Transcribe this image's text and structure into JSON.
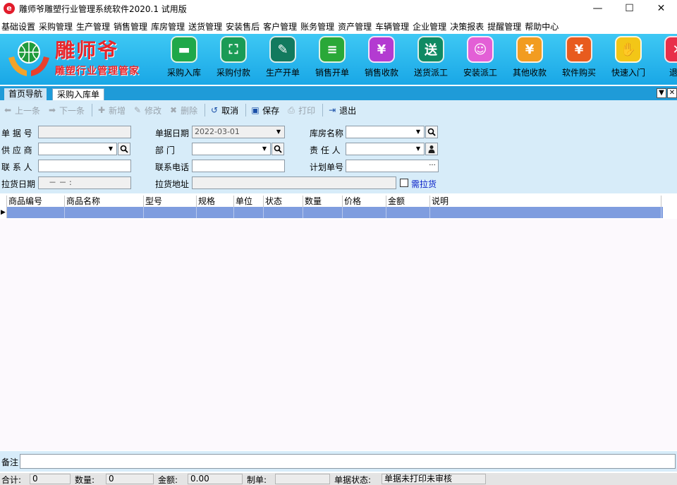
{
  "window": {
    "title": "雕师爷雕塑行业管理系统软件2020.1 试用版",
    "logo_glyph": "e",
    "minimize": "—",
    "maximize": "☐",
    "close": "✕"
  },
  "menu": [
    "基础设置",
    "采购管理",
    "生产管理",
    "销售管理",
    "库房管理",
    "送货管理",
    "安装售后",
    "客户管理",
    "账务管理",
    "资产管理",
    "车辆管理",
    "企业管理",
    "决策报表",
    "提醒管理",
    "帮助中心"
  ],
  "brand": {
    "name": "雕师爷",
    "subtitle": "雕塑行业管理管家"
  },
  "toolbar": [
    {
      "label": "采购入库",
      "icon": "folder-icon",
      "color": "#1fa84a",
      "glyph": "▬"
    },
    {
      "label": "采购付款",
      "icon": "scan-icon",
      "color": "#1a9b55",
      "glyph": "⛶"
    },
    {
      "label": "生产开单",
      "icon": "document-icon",
      "color": "#127a5e",
      "glyph": "✎"
    },
    {
      "label": "销售开单",
      "icon": "cart-doc-icon",
      "color": "#2aa838",
      "glyph": "≡"
    },
    {
      "label": "销售收款",
      "icon": "receipt-icon",
      "color": "#b33bd1",
      "glyph": "¥"
    },
    {
      "label": "送货派工",
      "icon": "truck-icon",
      "color": "#0f8a63",
      "glyph": "送"
    },
    {
      "label": "安装派工",
      "icon": "users-icon",
      "color": "#e35fd6",
      "glyph": "☺"
    },
    {
      "label": "其他收款",
      "icon": "money-bag-icon",
      "color": "#f29c20",
      "glyph": "¥"
    },
    {
      "label": "软件购买",
      "icon": "purchase-icon",
      "color": "#e85b1e",
      "glyph": "¥"
    },
    {
      "label": "快速入门",
      "icon": "hand-icon",
      "color": "#f3c617",
      "glyph": "✋"
    },
    {
      "label": "退出",
      "icon": "exit-icon",
      "color": "#e8304a",
      "glyph": "✕"
    }
  ],
  "tabs": {
    "home": "首页导航",
    "current": "采购入库单",
    "dropdown": "▼",
    "close": "✕"
  },
  "actions": [
    {
      "label": "上一条",
      "enabled": false,
      "icon": "prev-icon",
      "glyph": "⬅"
    },
    {
      "label": "下一条",
      "enabled": false,
      "icon": "next-icon",
      "glyph": "➡"
    },
    {
      "label": "新增",
      "enabled": false,
      "icon": "add-icon",
      "glyph": "✚"
    },
    {
      "label": "修改",
      "enabled": false,
      "icon": "edit-icon",
      "glyph": "✎"
    },
    {
      "label": "删除",
      "enabled": false,
      "icon": "delete-icon",
      "glyph": "✖"
    },
    {
      "label": "取消",
      "enabled": true,
      "icon": "cancel-icon",
      "glyph": "↺"
    },
    {
      "label": "保存",
      "enabled": true,
      "icon": "save-icon",
      "glyph": "▣"
    },
    {
      "label": "打印",
      "enabled": false,
      "icon": "print-icon",
      "glyph": "⎙"
    },
    {
      "label": "退出",
      "enabled": true,
      "icon": "exit-icon",
      "glyph": "⇥"
    }
  ],
  "form": {
    "doc_no_label": "单 据 号",
    "doc_no_value": "",
    "doc_date_label": "单据日期",
    "doc_date_value": "2022-03-01",
    "warehouse_label": "库房名称",
    "warehouse_value": "",
    "supplier_label": "供 应 商",
    "supplier_value": "",
    "dept_label": "部    门",
    "dept_value": "",
    "owner_label": "责 任 人",
    "owner_value": "",
    "contact_label": "联 系 人",
    "contact_value": "",
    "phone_label": "联系电话",
    "phone_value": "",
    "plan_no_label": "计划单号",
    "plan_no_value": "",
    "plan_no_button": "···",
    "pickup_date_label": "拉货日期",
    "pickup_date_value": "－   －         :",
    "pickup_addr_label": "拉货地址",
    "pickup_addr_value": "",
    "need_pickup_label": "需拉货",
    "need_pickup_checked": false
  },
  "grid": {
    "columns": [
      "商品编号",
      "商品名称",
      "型号",
      "规格",
      "单位",
      "状态",
      "数量",
      "价格",
      "金额",
      "说明"
    ],
    "row_marker": "▶"
  },
  "remark": {
    "label": "备注",
    "value": ""
  },
  "status": {
    "total_label": "合计:",
    "total_value": "0",
    "qty_label": "数量:",
    "qty_value": "0",
    "amount_label": "金额:",
    "amount_value": "0.00",
    "maker_label": "制单:",
    "maker_value": "",
    "doc_status_label": "单据状态:",
    "doc_status_value": "单据未打印未审核"
  }
}
